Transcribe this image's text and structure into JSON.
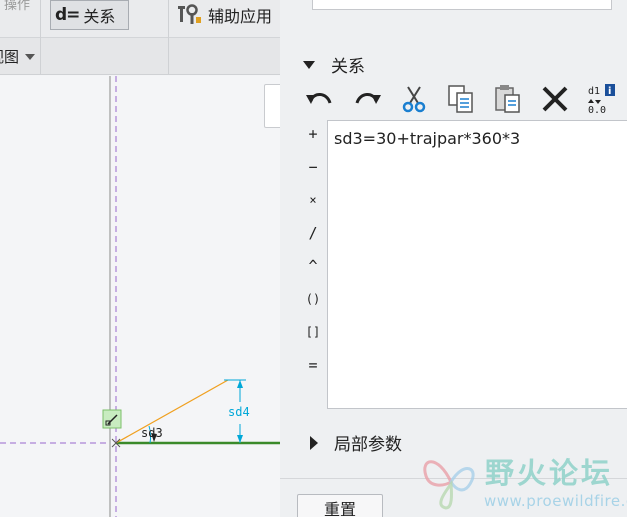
{
  "ribbon": {
    "cut_label": "操作",
    "relations_icon": "d=",
    "relations_label": "关系",
    "assist_label": "辅助应用",
    "view_label": "视图"
  },
  "canvas": {
    "dim_sd3": "sd3",
    "dim_sd4": "sd4",
    "colors": {
      "construction": "#9966cc",
      "centerline": "#8a8a8a",
      "sketch_line": "#3a8a2a",
      "angle_line": "#f0a020",
      "dimension": "#00a8d8"
    }
  },
  "panel": {
    "relations_section": "关系",
    "toolbar": [
      {
        "name": "undo-icon"
      },
      {
        "name": "redo-icon"
      },
      {
        "name": "cut-icon"
      },
      {
        "name": "copy-icon"
      },
      {
        "name": "paste-icon"
      },
      {
        "name": "delete-icon"
      },
      {
        "name": "show-values-icon",
        "text_top": "d1",
        "text_bottom": "0.0"
      }
    ],
    "operators": [
      "+",
      "−",
      "×",
      "/",
      "^",
      "()",
      "[]",
      "="
    ],
    "editor_text": "sd3=30+trajpar*360*3",
    "local_params_section": "局部参数",
    "reset_label": "重置"
  },
  "watermark": {
    "title": "野火论坛",
    "url": "www.proewildfire.cn"
  }
}
